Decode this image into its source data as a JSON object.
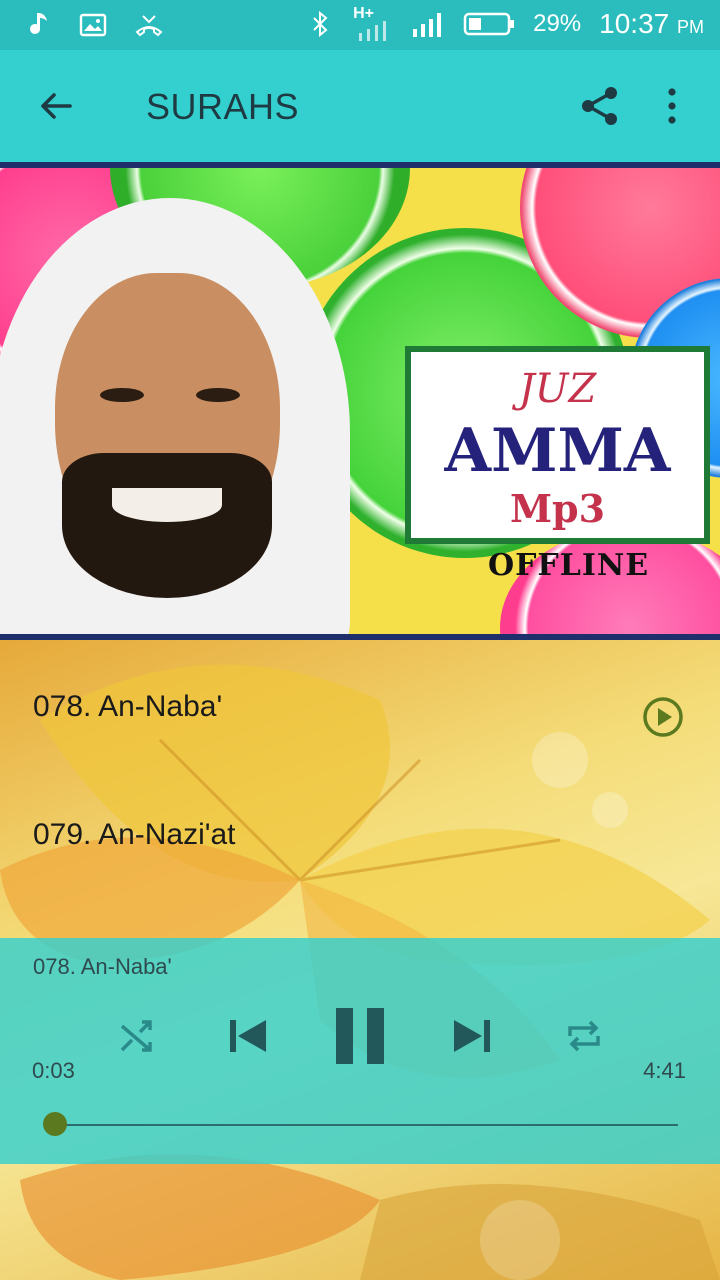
{
  "status_bar": {
    "battery": "29%",
    "time": "10:37",
    "ampm": "PM",
    "network": "H+"
  },
  "app_bar": {
    "title": "SURAHS"
  },
  "banner": {
    "juz": "JUZ",
    "amma": "AMMA",
    "mp3": "Mp3",
    "offline": "OFFLINE"
  },
  "list": {
    "items": [
      {
        "label": "078. An-Naba'"
      },
      {
        "label": "079. An-Nazi'at"
      }
    ]
  },
  "player": {
    "now_playing": "078. An-Naba'",
    "current_time": "0:03",
    "total_time": "4:41",
    "progress_fraction": 0.011
  },
  "colors": {
    "accent": "#34cfcf",
    "title_text": "#1e3b44",
    "play_icon": "#5b7a1f"
  }
}
